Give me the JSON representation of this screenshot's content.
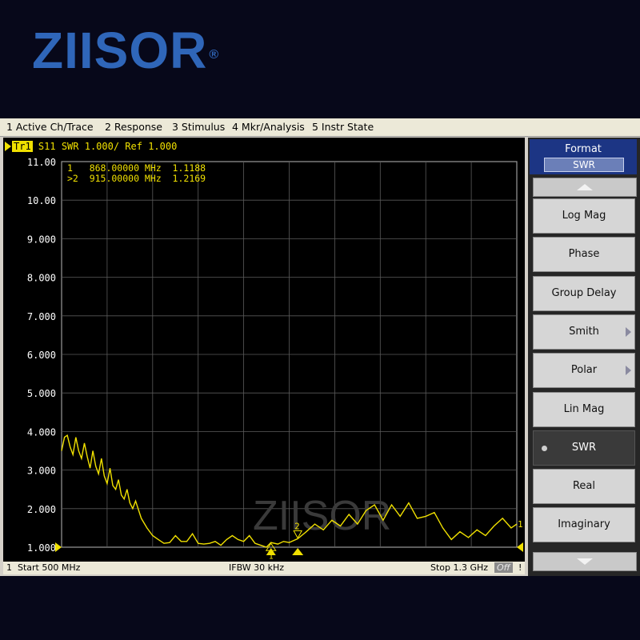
{
  "brand": {
    "logo_text": "ZIISOR",
    "reg_mark": "®",
    "watermark": "ZIISOR"
  },
  "menu": [
    "1 Active Ch/Trace",
    "2 Response",
    "3 Stimulus",
    "4 Mkr/Analysis",
    "5 Instr State"
  ],
  "trace": {
    "tag": "Tr1",
    "header": "S11  SWR 1.000/ Ref 1.000",
    "color": "#f0e000"
  },
  "markers": {
    "line1": "1   868.00000 MHz  1.1188",
    "line2": ">2  915.00000 MHz  1.2169",
    "m1_label": "1",
    "m2_label": "2",
    "end_label": "1"
  },
  "status": {
    "channel": "1",
    "start": "Start 500 MHz",
    "ifbw": "IFBW 30 kHz",
    "stop": "Stop 1.3 GHz",
    "off": "Off",
    "bang": "!"
  },
  "softkeys": {
    "title": "Format",
    "value": "SWR",
    "items": [
      {
        "label": "Log Mag",
        "selected": false,
        "submenu": false
      },
      {
        "label": "Phase",
        "selected": false,
        "submenu": false
      },
      {
        "label": "Group Delay",
        "selected": false,
        "submenu": false
      },
      {
        "label": "Smith",
        "selected": false,
        "submenu": true
      },
      {
        "label": "Polar",
        "selected": false,
        "submenu": true
      },
      {
        "label": "Lin Mag",
        "selected": false,
        "submenu": false
      },
      {
        "label": "SWR",
        "selected": true,
        "submenu": false
      },
      {
        "label": "Real",
        "selected": false,
        "submenu": false
      },
      {
        "label": "Imaginary",
        "selected": false,
        "submenu": false
      }
    ]
  },
  "chart_data": {
    "type": "line",
    "x_unit": "MHz",
    "x_range": [
      500,
      1300
    ],
    "ylim": [
      1.0,
      11.0
    ],
    "yticks": [
      "11.00",
      "10.00",
      "9.000",
      "8.000",
      "7.000",
      "6.000",
      "5.000",
      "4.000",
      "3.000",
      "2.000",
      "1.000"
    ],
    "grid": true,
    "series": [
      {
        "x": [
          500,
          505,
          510,
          515,
          520,
          525,
          530,
          535,
          540,
          545,
          550,
          555,
          560,
          565,
          570,
          575,
          580,
          585,
          590,
          595,
          600,
          605,
          610,
          615,
          620,
          625,
          630,
          640,
          650,
          660,
          670,
          680,
          690,
          700,
          710,
          720,
          730,
          740,
          750,
          760,
          770,
          780,
          790,
          800,
          810,
          820,
          830,
          840,
          850,
          860,
          868,
          880,
          890,
          900,
          915,
          930,
          945,
          960,
          975,
          990,
          1005,
          1020,
          1035,
          1050,
          1065,
          1080,
          1095,
          1110,
          1125,
          1140,
          1155,
          1170,
          1185,
          1200,
          1215,
          1230,
          1245,
          1260,
          1275,
          1290,
          1300
        ],
        "y": [
          3.5,
          3.85,
          3.9,
          3.6,
          3.4,
          3.85,
          3.5,
          3.3,
          3.7,
          3.35,
          3.05,
          3.5,
          3.1,
          2.9,
          3.3,
          2.85,
          2.65,
          3.05,
          2.6,
          2.5,
          2.75,
          2.35,
          2.25,
          2.5,
          2.15,
          2.0,
          2.2,
          1.75,
          1.5,
          1.3,
          1.2,
          1.1,
          1.12,
          1.3,
          1.15,
          1.15,
          1.35,
          1.1,
          1.08,
          1.1,
          1.15,
          1.05,
          1.2,
          1.3,
          1.2,
          1.15,
          1.3,
          1.1,
          1.05,
          1.0,
          1.12,
          1.08,
          1.15,
          1.12,
          1.22,
          1.4,
          1.6,
          1.45,
          1.7,
          1.55,
          1.85,
          1.6,
          1.95,
          2.1,
          1.7,
          2.1,
          1.8,
          2.15,
          1.75,
          1.8,
          1.9,
          1.5,
          1.2,
          1.4,
          1.25,
          1.45,
          1.3,
          1.55,
          1.75,
          1.5,
          1.6
        ]
      }
    ]
  }
}
